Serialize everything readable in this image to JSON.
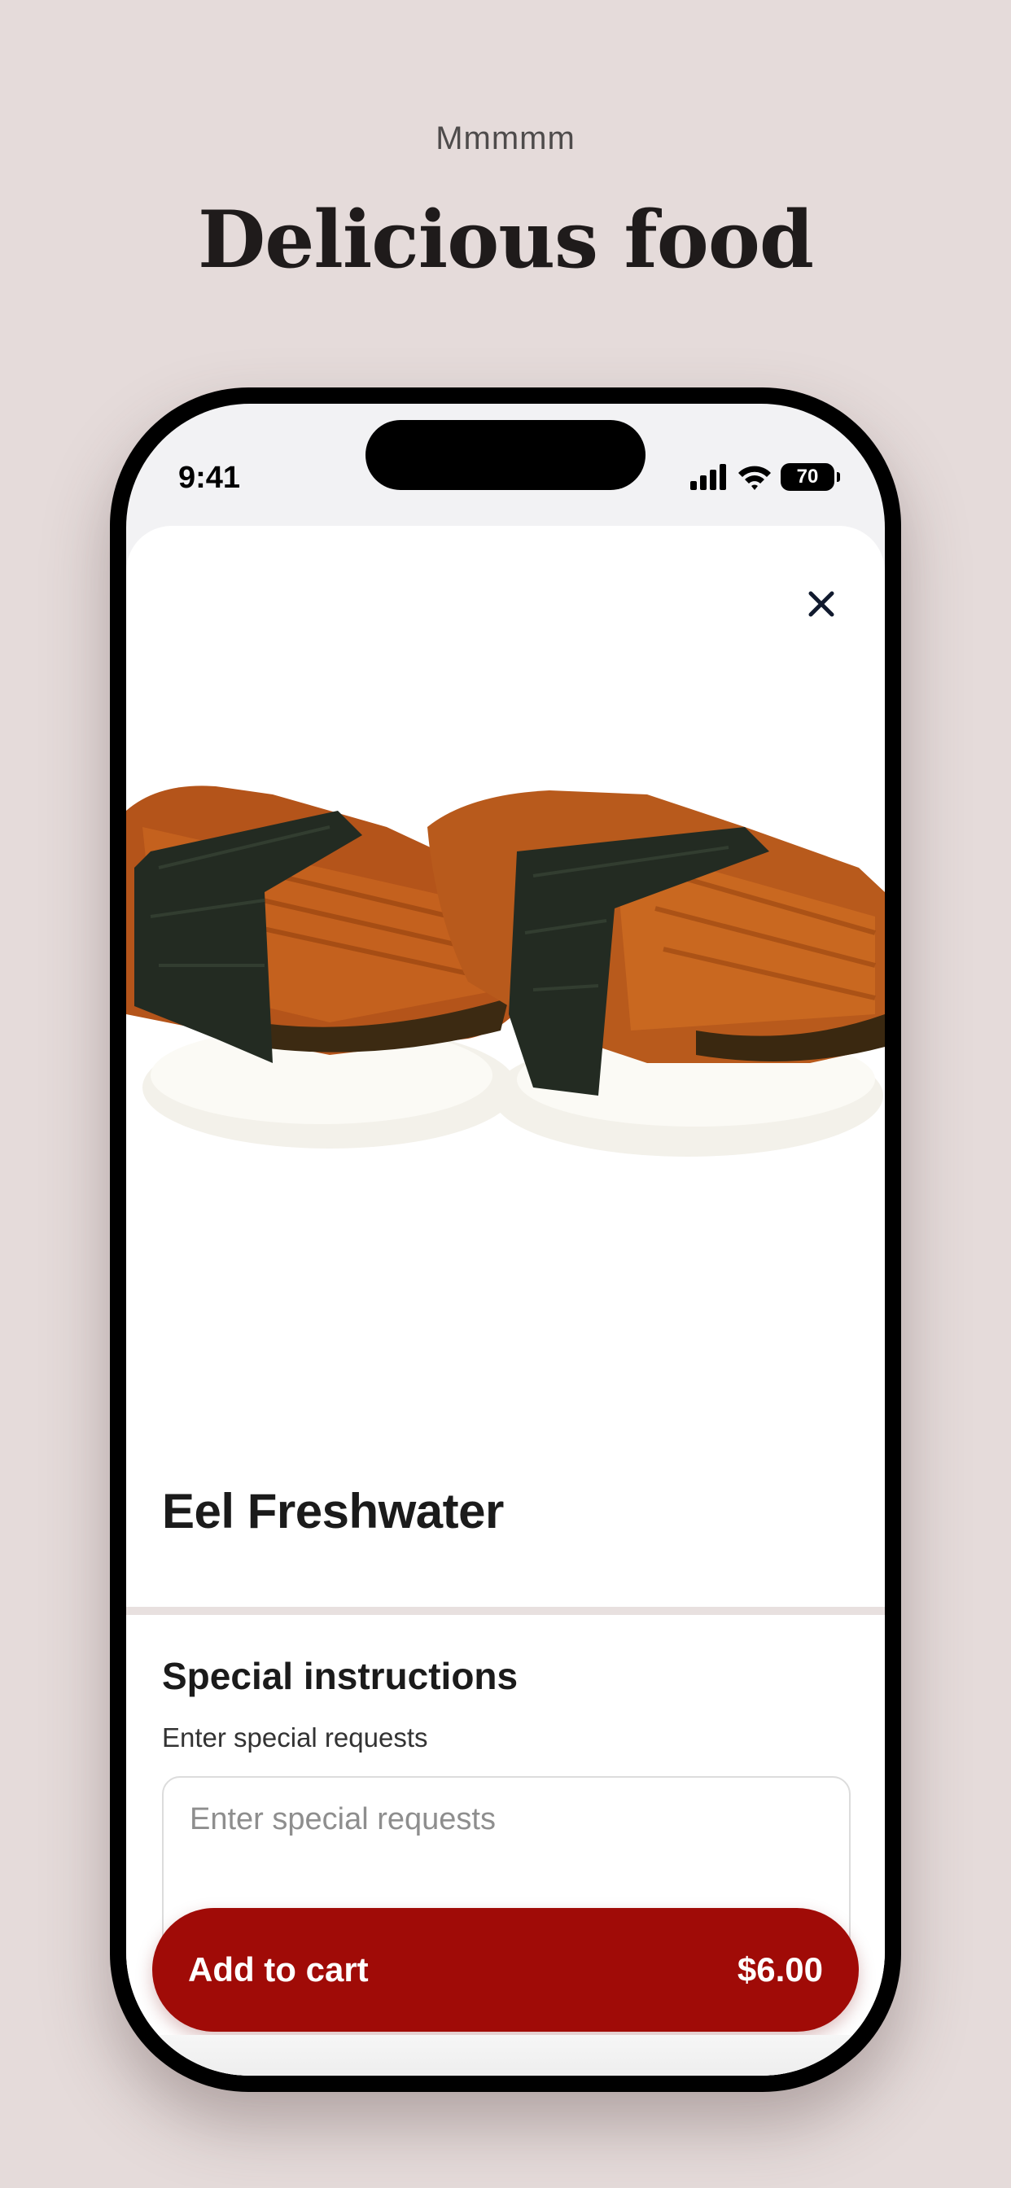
{
  "header": {
    "eyebrow": "Mmmmm",
    "title": "Delicious food"
  },
  "status_bar": {
    "time": "9:41",
    "battery": "70"
  },
  "product": {
    "name": "Eel Freshwater",
    "image_icon": "eel-nigiri-image"
  },
  "instructions": {
    "title": "Special instructions",
    "subtitle": "Enter special requests",
    "placeholder": "Enter special requests",
    "value": ""
  },
  "cart": {
    "label": "Add to cart",
    "price": "$6.00"
  },
  "colors": {
    "background": "#e5dbda",
    "accent": "#a00b07",
    "text": "#1b1b1b"
  }
}
